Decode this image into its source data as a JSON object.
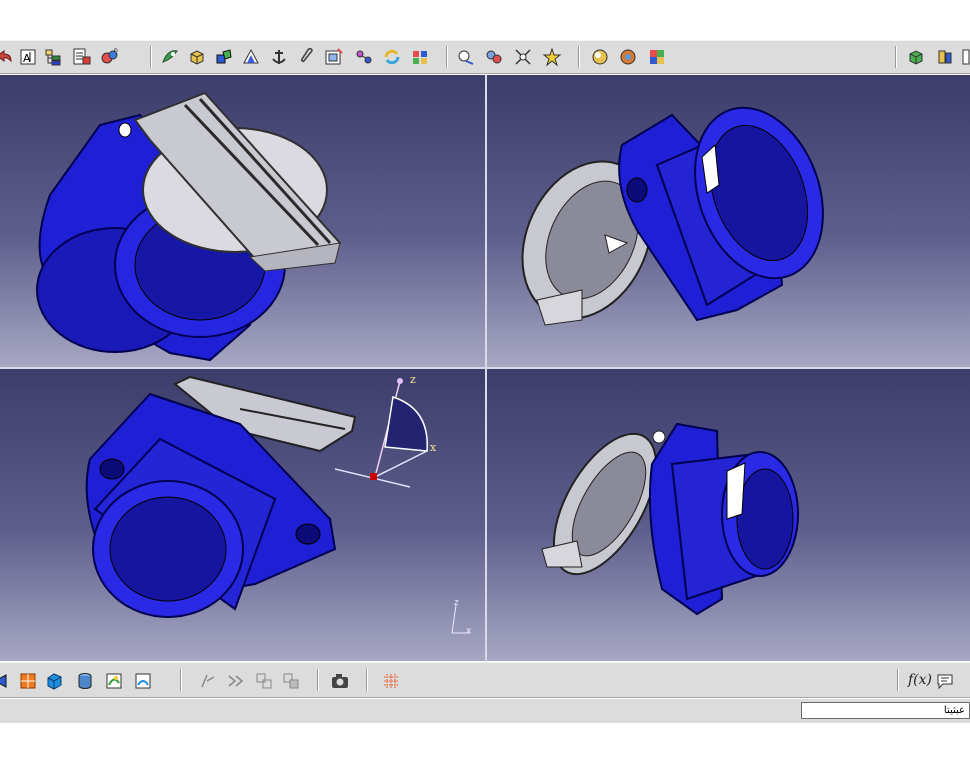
{
  "toolbar_top": {
    "icons": [
      "undo-arrow-icon",
      "text-annotation-icon",
      "hierarchy-tree-icon",
      "display-tree-icon",
      "update-model-icon",
      "fly-mode-icon",
      "fit-all-icon",
      "normal-view-icon",
      "anchor-icon",
      "paperclip-icon",
      "zoom-area-icon",
      "link-icon",
      "refresh-icon",
      "quick-view-icon",
      "swap-hide-show-icon",
      "hide-show-icon",
      "magic-wand-icon",
      "render-style-icon",
      "materials-icon",
      "apply-color-icon",
      "cube-view-icon",
      "isometric-view-icon"
    ]
  },
  "toolbar_bottom": {
    "icons": [
      "rotate-view-icon",
      "orange-cube-icon",
      "blue-cube-icon",
      "cylinder-icon",
      "shading-icon",
      "edges-icon",
      "sketcher-icon",
      "constraint-icon",
      "pattern-icon",
      "pattern-2-icon",
      "camera-icon",
      "grid-icon",
      "formula-icon",
      "knowledge-advisor-icon"
    ],
    "formula_label": "f(x)"
  },
  "axis_labels": {
    "z": "z",
    "x": "x"
  },
  "command_input": {
    "value": "عبثيتا"
  },
  "colors": {
    "part_blue": "#1f1fd6",
    "part_grey": "#d6d6dc",
    "viewport_top": "#3d3d6b",
    "viewport_bottom": "#a7a7c3",
    "compass_red": "#cc0000"
  }
}
